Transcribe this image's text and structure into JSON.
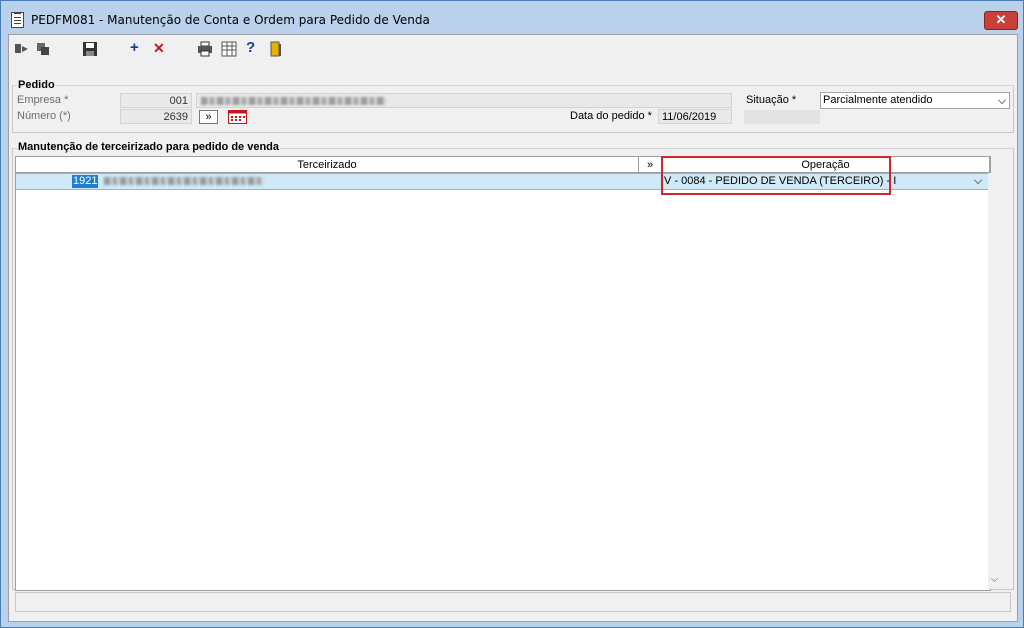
{
  "window": {
    "title": "PEDFM081 - Manutenção de Conta e Ordem para Pedido de Venda",
    "close_label": "✕"
  },
  "toolbar": {
    "items": [
      {
        "name": "first-record-icon"
      },
      {
        "name": "copy-record-icon"
      },
      {
        "name": "save-icon"
      },
      {
        "name": "add-icon",
        "glyph": "+"
      },
      {
        "name": "delete-icon",
        "glyph": "✕"
      },
      {
        "name": "print-icon"
      },
      {
        "name": "spreadsheet-icon"
      },
      {
        "name": "help-icon",
        "glyph": "?"
      },
      {
        "name": "exit-door-icon"
      }
    ]
  },
  "pedido": {
    "group_title": "Pedido",
    "empresa_label": "Empresa *",
    "empresa_value": "001",
    "numero_label": "Número (*)",
    "numero_value": "2639",
    "next_button": "»",
    "data_label": "Data do pedido *",
    "data_value": "11/06/2019",
    "situacao_label": "Situação *",
    "situacao_value": "Parcialmente atendido"
  },
  "manutencao": {
    "group_title": "Manutenção de terceirizado para pedido de venda",
    "columns": [
      "Terceirizado",
      "»",
      "Operação"
    ],
    "rows": [
      {
        "code": "1921",
        "operacao": "V - 0084 - PEDIDO DE VENDA (TERCEIRO) - I"
      }
    ]
  },
  "colors": {
    "accent_red": "#d2262b",
    "selected_row": "#cfe9f7",
    "title_bg": "#b9d1ea"
  }
}
